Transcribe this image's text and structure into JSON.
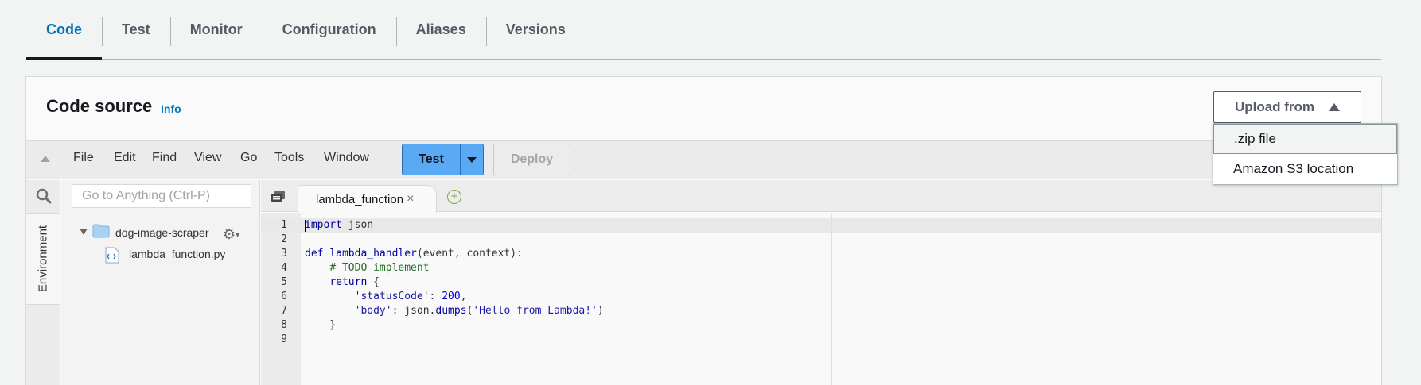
{
  "tabs": [
    "Code",
    "Test",
    "Monitor",
    "Configuration",
    "Aliases",
    "Versions"
  ],
  "active_tab": "Code",
  "code_source": {
    "title": "Code source",
    "info": "Info"
  },
  "upload": {
    "label": "Upload from",
    "options": [
      ".zip file",
      "Amazon S3 location"
    ],
    "highlighted": ".zip file"
  },
  "ide": {
    "menus": [
      "File",
      "Edit",
      "Find",
      "View",
      "Go",
      "Tools",
      "Window"
    ],
    "test_label": "Test",
    "deploy_label": "Deploy",
    "goto_placeholder": "Go to Anything (Ctrl-P)",
    "environment_label": "Environment",
    "folder": "dog-image-scraper",
    "file": "lambda_function.py",
    "open_tab": "lambda_function",
    "close_glyph": "×",
    "add_glyph": "+"
  },
  "code_lines": [
    "import json",
    "",
    "def lambda_handler(event, context):",
    "    # TODO implement",
    "    return {",
    "        'statusCode': 200,",
    "        'body': json.dumps('Hello from Lambda!')",
    "    }",
    ""
  ],
  "line_numbers": [
    "1",
    "2",
    "3",
    "4",
    "5",
    "6",
    "7",
    "8",
    "9"
  ],
  "colors": {
    "accent": "#0073bb",
    "test_button": "#5aa9f5",
    "keyword": "#0000a2",
    "comment": "#236e24",
    "string": "#1a1aa6"
  },
  "icons": [
    "search-icon",
    "folder-icon",
    "python-file-icon",
    "gear-icon",
    "tabs-menu-icon",
    "add-tab-icon",
    "close-icon",
    "caret-up-icon",
    "caret-down-icon"
  ]
}
